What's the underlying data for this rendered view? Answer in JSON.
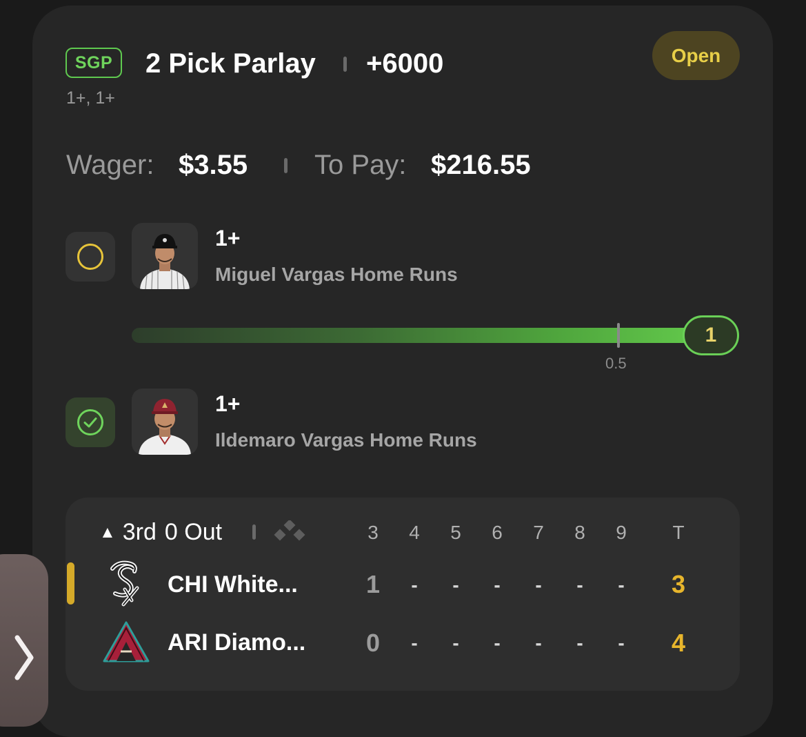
{
  "bet": {
    "badge": "SGP",
    "title": "2 Pick Parlay",
    "odds": "+6000",
    "legs_summary": "1+, 1+",
    "status": "Open",
    "wager_label": "Wager:",
    "wager_value": "$3.55",
    "payout_label": "To Pay:",
    "payout_value": "$216.55"
  },
  "legs": [
    {
      "line": "1+",
      "market": "Miguel Vargas Home Runs",
      "status_icon": "pending-circle-icon",
      "status_color": "#e7c43a",
      "progress": {
        "current": "1",
        "threshold": "0.5",
        "fraction": 1.0
      }
    },
    {
      "line": "1+",
      "market": "Ildemaro Vargas Home Runs",
      "status_icon": "check-circle-icon",
      "status_color": "#6fd45c"
    }
  ],
  "game": {
    "half": "▲",
    "inning": "3rd",
    "outs": "0 Out",
    "innings": [
      "3",
      "4",
      "5",
      "6",
      "7",
      "8",
      "9"
    ],
    "total_label": "T",
    "teams": [
      {
        "name": "CHI White...",
        "scores": [
          "1",
          "-",
          "-",
          "-",
          "-",
          "-",
          "-"
        ],
        "total": "3",
        "logo": "white-sox-logo"
      },
      {
        "name": "ARI Diamo...",
        "scores": [
          "0",
          "-",
          "-",
          "-",
          "-",
          "-",
          "-"
        ],
        "total": "4",
        "logo": "diamondbacks-logo"
      }
    ]
  },
  "colors": {
    "accent_green": "#6fd45c",
    "accent_gold": "#e7b52c",
    "card_bg": "#262626"
  }
}
